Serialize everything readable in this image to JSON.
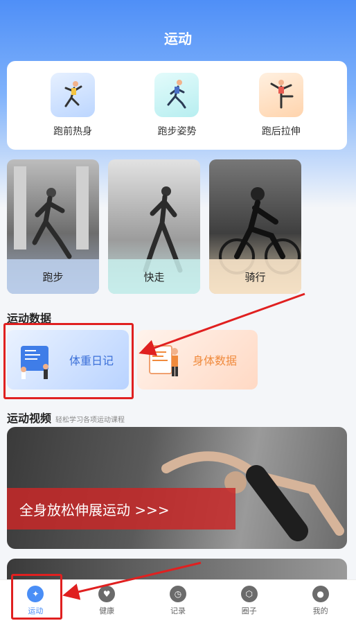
{
  "header": {
    "title": "运动"
  },
  "warmup": [
    {
      "label": "跑前热身",
      "icon": "warmup-icon"
    },
    {
      "label": "跑步姿势",
      "icon": "running-icon"
    },
    {
      "label": "跑后拉伸",
      "icon": "stretch-icon"
    }
  ],
  "sports": [
    {
      "label": "跑步"
    },
    {
      "label": "快走"
    },
    {
      "label": "骑行"
    }
  ],
  "sport_data": {
    "title": "运动数据",
    "weight_label": "体重日记",
    "body_label": "身体数据"
  },
  "video": {
    "title": "运动视频",
    "subtitle": "轻松学习各项运动课程",
    "banner": "全身放松伸展运动 >>>"
  },
  "tabs": [
    {
      "label": "运动",
      "active": true
    },
    {
      "label": "健康",
      "active": false
    },
    {
      "label": "记录",
      "active": false
    },
    {
      "label": "圈子",
      "active": false
    },
    {
      "label": "我的",
      "active": false
    }
  ],
  "colors": {
    "accent": "#4a8ef6",
    "highlight": "#e02020"
  }
}
